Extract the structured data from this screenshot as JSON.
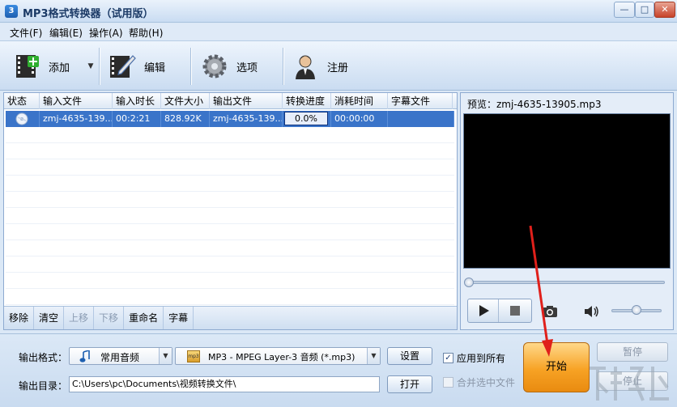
{
  "window": {
    "title": "MP3格式转换器（试用版）",
    "icon_text": "3"
  },
  "menu": [
    "文件(F)",
    "编辑(E)",
    "操作(A)",
    "帮助(H)"
  ],
  "toolbar": {
    "add": "添加",
    "edit": "编辑",
    "options": "选项",
    "register": "注册"
  },
  "table": {
    "headers": [
      "状态",
      "输入文件",
      "输入时长",
      "文件大小",
      "输出文件",
      "转换进度",
      "消耗时间",
      "字幕文件"
    ],
    "rows": [
      {
        "input": "zmj-4635-139...",
        "duration": "00:2:21",
        "size": "828.92K",
        "output": "zmj-4635-139...",
        "progress": "0.0%",
        "elapsed": "00:00:00",
        "subtitle": ""
      }
    ]
  },
  "actions": {
    "remove": "移除",
    "clear": "清空",
    "up": "上移",
    "down": "下移",
    "rename": "重命名",
    "subtitle": "字幕"
  },
  "preview": {
    "label": "预览：zmj-4635-13905.mp3",
    "seek": 0.0,
    "volume": 0.5
  },
  "output": {
    "format_label": "输出格式：",
    "format_category": "常用音频",
    "format_value": "MP3 - MPEG Layer-3 音频 (*.mp3)",
    "format_icon_text": "mp3",
    "settings_btn": "设置",
    "dir_label": "输出目录：",
    "dir_value": "C:\\Users\\pc\\Documents\\视频转换文件\\",
    "open_btn": "打开",
    "apply_all": "应用到所有",
    "merge": "合并选中文件",
    "start": "开始",
    "pause": "暂停",
    "stop": "停止"
  },
  "colors": {
    "selection": "#3a74c9",
    "start_button": "#f7a224",
    "annotation": "#e0201b"
  }
}
